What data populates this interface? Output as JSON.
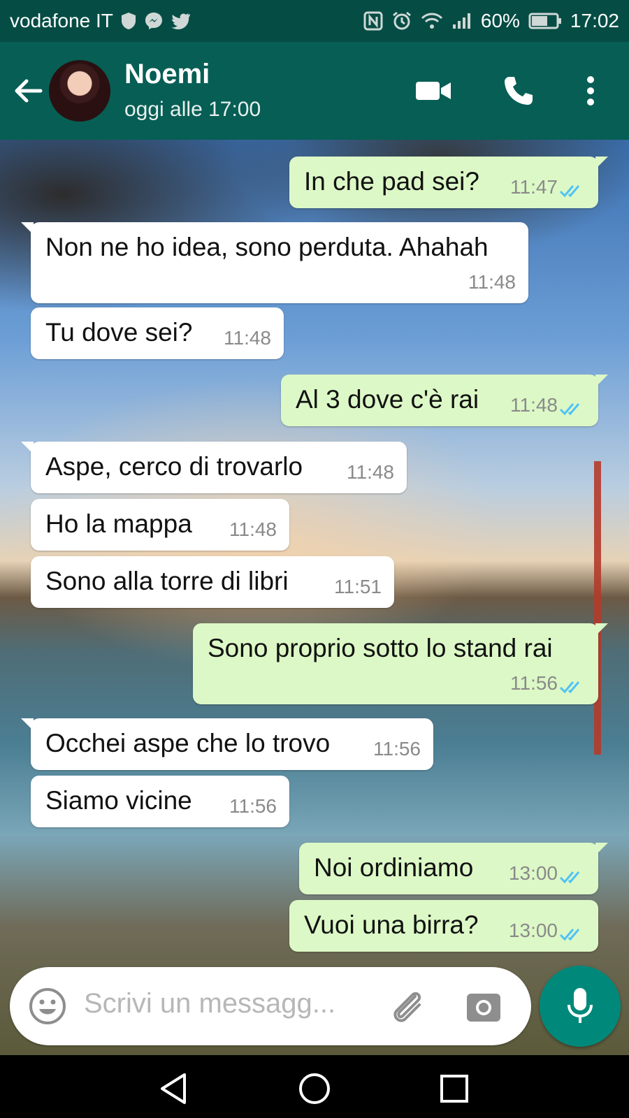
{
  "status_bar": {
    "carrier": "vodafone IT",
    "battery": "60%",
    "time": "17:02",
    "icons": [
      "shield-icon",
      "messenger-icon",
      "twitter-icon",
      "nfc-icon",
      "alarm-icon",
      "wifi-icon",
      "signal-icon",
      "battery-icon"
    ]
  },
  "header": {
    "contact_name": "Noemi",
    "contact_status": "oggi alle 17:00",
    "icons": [
      "back-arrow-icon",
      "video-call-icon",
      "phone-icon",
      "more-options-icon"
    ]
  },
  "messages": [
    {
      "direction": "out",
      "text": "In che pad sei?",
      "time": "11:47",
      "read": true
    },
    {
      "direction": "in",
      "text": "Non ne ho idea, sono perduta. Ahahah",
      "time": "11:48"
    },
    {
      "direction": "in",
      "text": "Tu dove sei?",
      "time": "11:48"
    },
    {
      "direction": "out",
      "text": "Al 3 dove c'è rai",
      "time": "11:48",
      "read": true
    },
    {
      "direction": "in",
      "text": "Aspe, cerco di trovarlo",
      "time": "11:48"
    },
    {
      "direction": "in",
      "text": "Ho la mappa",
      "time": "11:48"
    },
    {
      "direction": "in",
      "text": "Sono alla torre di libri",
      "time": "11:51"
    },
    {
      "direction": "out",
      "text": "Sono proprio sotto lo stand rai",
      "time": "11:56",
      "read": true
    },
    {
      "direction": "in",
      "text": "Occhei aspe che lo trovo",
      "time": "11:56"
    },
    {
      "direction": "in",
      "text": "Siamo vicine",
      "time": "11:56"
    },
    {
      "direction": "out",
      "text": "Noi ordiniamo",
      "time": "13:00",
      "read": true
    },
    {
      "direction": "out",
      "text": "Vuoi una birra?",
      "time": "13:00",
      "read": true
    }
  ],
  "composer": {
    "placeholder": "Scrivi un messagg...",
    "icons": [
      "emoji-icon",
      "attach-icon",
      "camera-icon",
      "microphone-icon"
    ]
  },
  "nav_bar": {
    "icons": [
      "back-triangle-icon",
      "home-circle-icon",
      "recents-square-icon"
    ]
  },
  "colors": {
    "header": "#075e54",
    "status_bar": "#054d44",
    "outgoing_bubble": "#dcf8c6",
    "incoming_bubble": "#ffffff",
    "read_ticks": "#4fc3f7",
    "mic_button": "#00897b"
  }
}
